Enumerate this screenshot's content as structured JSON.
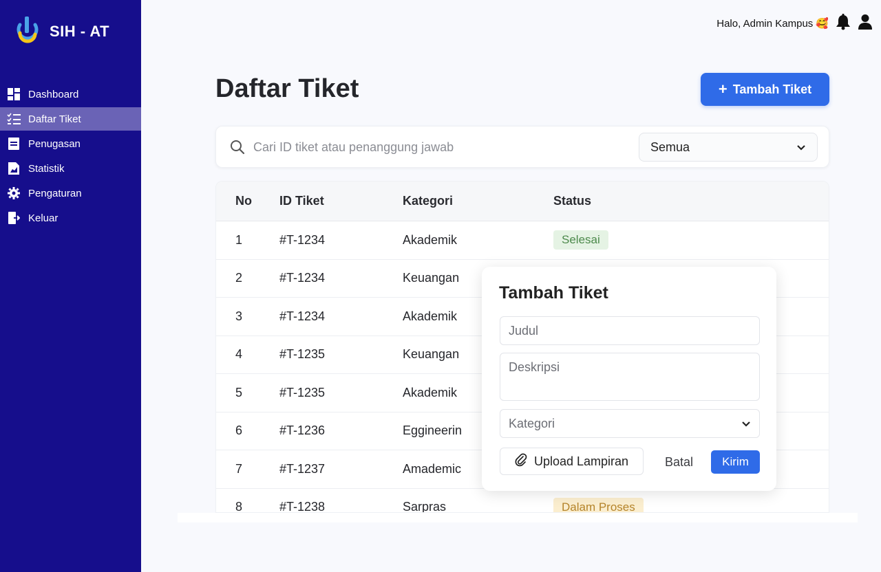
{
  "app": {
    "title": "SIH - AT"
  },
  "sidebar": {
    "items": [
      {
        "label": "Dashboard",
        "icon": "dashboard-icon"
      },
      {
        "label": "Daftar Tiket",
        "icon": "checklist-icon",
        "active": true
      },
      {
        "label": "Penugasan",
        "icon": "assignment-icon"
      },
      {
        "label": "Statistik",
        "icon": "statistics-icon"
      },
      {
        "label": "Pengaturan",
        "icon": "gear-icon"
      },
      {
        "label": "Keluar",
        "icon": "logout-icon"
      }
    ]
  },
  "header": {
    "greeting": "Halo, Admin Kampus",
    "emoji": "🥰"
  },
  "main": {
    "title": "Daftar Tiket",
    "add_button": "Tambah Tiket",
    "search_placeholder": "Cari ID tiket atau penanggung jawab",
    "filter_value": "Semua"
  },
  "table": {
    "headers": {
      "no": "No",
      "id": "ID Tiket",
      "category": "Kategori",
      "status": "Status"
    },
    "rows": [
      {
        "no": "1",
        "id": "#T-1234",
        "category": "Akademik",
        "status": "Selesai"
      },
      {
        "no": "2",
        "id": "#T-1234",
        "category": "Keuangan",
        "status": ""
      },
      {
        "no": "3",
        "id": "#T-1234",
        "category": "Akademik",
        "status": ""
      },
      {
        "no": "4",
        "id": "#T-1235",
        "category": "Keuangan",
        "status": ""
      },
      {
        "no": "5",
        "id": "#T-1235",
        "category": "Akademik",
        "status": ""
      },
      {
        "no": "6",
        "id": "#T-1236",
        "category": "Eggineerin",
        "status": ""
      },
      {
        "no": "7",
        "id": "#T-1237",
        "category": "Amademic",
        "status": ""
      },
      {
        "no": "8",
        "id": "#T-1238",
        "category": "Sarpras",
        "status": "Dalam Proses"
      }
    ]
  },
  "modal": {
    "title": "Tambah Tiket",
    "title_placeholder": "Judul",
    "description_placeholder": "Deskripsi",
    "category_placeholder": "Kategori",
    "upload_label": "Upload Lampiran",
    "cancel_label": "Batal",
    "submit_label": "Kirim"
  },
  "colors": {
    "sidebar": "#160e8c",
    "sidebar_active": "#6a63b6",
    "primary": "#2f6be8",
    "badge_done_bg": "#e5f3e4",
    "badge_done_text": "#4d8a4c",
    "badge_process_bg": "#fbeecf",
    "badge_process_text": "#b5842a"
  }
}
